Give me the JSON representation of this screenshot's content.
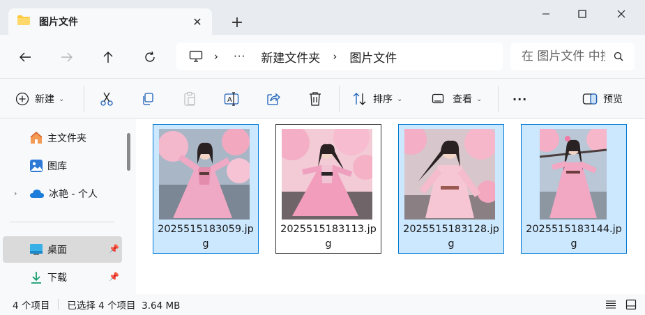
{
  "window": {
    "tab_title": "图片文件",
    "colors": {
      "accent": "#0078d4",
      "folder": "#ffc83d",
      "selection": "#cce8ff"
    }
  },
  "address": {
    "breadcrumbs": [
      "新建文件夹",
      "图片文件"
    ],
    "ellipsis": "···",
    "search_placeholder": "在 图片文件 中搜索"
  },
  "commands": {
    "new_label": "新建",
    "sort_label": "排序",
    "view_label": "查看",
    "more_label": "···",
    "preview_label": "预览"
  },
  "sidebar": {
    "items": [
      {
        "label": "主文件夹",
        "icon": "home-icon",
        "pinned": false
      },
      {
        "label": "图库",
        "icon": "gallery-icon",
        "pinned": false
      },
      {
        "label": "冰艳 - 个人",
        "icon": "onedrive-cloud-icon",
        "pinned": false
      },
      {
        "label": "桌面",
        "icon": "desktop-icon",
        "pinned": true
      },
      {
        "label": "下载",
        "icon": "download-icon",
        "pinned": true
      }
    ]
  },
  "files": [
    {
      "name": "2025515183059.jpg",
      "selected": true
    },
    {
      "name": "2025515183113.jpg",
      "selected": true
    },
    {
      "name": "2025515183128.jpg",
      "selected": true
    },
    {
      "name": "2025515183144.jpg",
      "selected": true
    }
  ],
  "status": {
    "count": "4 个项目",
    "selection": "已选择 4 个项目  3.64 MB"
  }
}
